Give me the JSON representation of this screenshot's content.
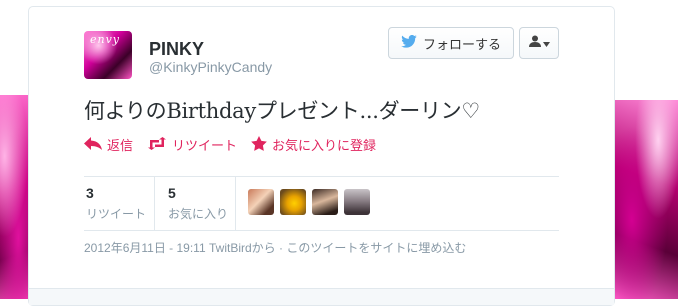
{
  "user": {
    "display_name": "PINKY",
    "screen_name": "@KinkyPinkyCandy",
    "avatar_text": "envy"
  },
  "follow_button": {
    "label": "フォローする",
    "icon": "twitter-bird-icon"
  },
  "user_menu": {
    "icon": "user-icon",
    "caret": "caret-down-icon"
  },
  "tweet": {
    "text": "何よりのBirthdayプレゼント...ダーリン♡"
  },
  "actions": [
    {
      "label": "返信",
      "icon": "reply-icon"
    },
    {
      "label": "リツイート",
      "icon": "retweet-icon"
    },
    {
      "label": "お気に入りに登録",
      "icon": "star-icon"
    }
  ],
  "stats": {
    "retweets": {
      "count": "3",
      "label": "リツイート"
    },
    "favorites": {
      "count": "5",
      "label": "お気に入り"
    }
  },
  "meta": {
    "timestamp": "2012年6月11日 - 19:11",
    "source": "TwitBirdから",
    "separator": "·",
    "embed_link": "このツイートをサイトに埋め込む"
  },
  "colors": {
    "action": "#e0245e",
    "twitter_blue": "#55acee",
    "muted": "#8899a6"
  }
}
